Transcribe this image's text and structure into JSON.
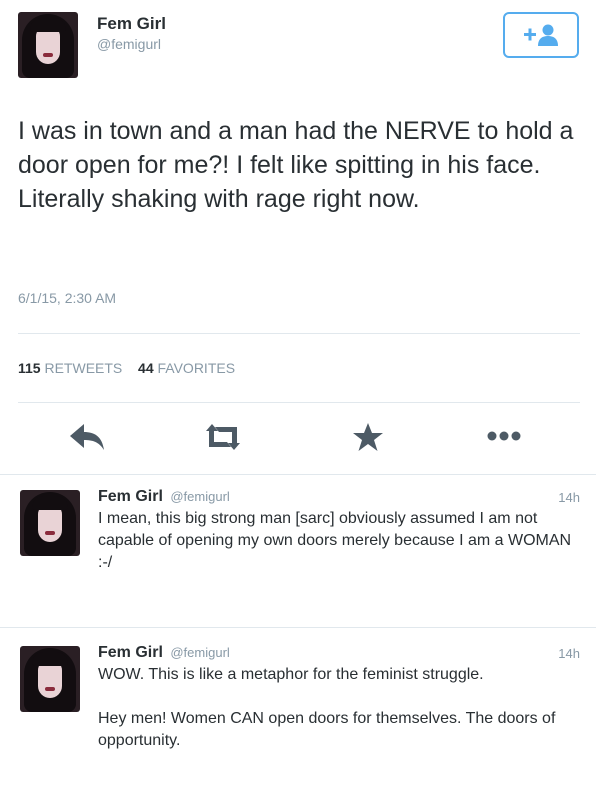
{
  "tweet": {
    "author_name": "Fem Girl",
    "author_handle": "@femigurl",
    "text": "I was in town and a man had the NERVE to hold a door open for me?! I felt like spitting in his face. Literally shaking with rage right now.",
    "timestamp": "6/1/15, 2:30 AM",
    "retweets_count": "115",
    "retweets_label": "RETWEETS",
    "favorites_count": "44",
    "favorites_label": "FAVORITES",
    "follow_icon": "follow-user-icon",
    "actions": [
      "reply-icon",
      "retweet-icon",
      "favorite-icon",
      "more-icon"
    ]
  },
  "replies": [
    {
      "author_name": "Fem Girl",
      "author_handle": "@femigurl",
      "time": "14h",
      "text": "I mean, this big strong man [sarc] obviously assumed I am not capable of opening my own doors merely because I am a WOMAN :-/"
    },
    {
      "author_name": "Fem Girl",
      "author_handle": "@femigurl",
      "time": "14h",
      "text": "WOW. This is like a metaphor for the feminist struggle.",
      "text_2": "Hey men! Women CAN open doors for themselves. The doors of opportunity."
    }
  ],
  "colors": {
    "accent": "#55acee",
    "text": "#292f33",
    "muted": "#8899a6",
    "divider": "#e1e8ed"
  }
}
